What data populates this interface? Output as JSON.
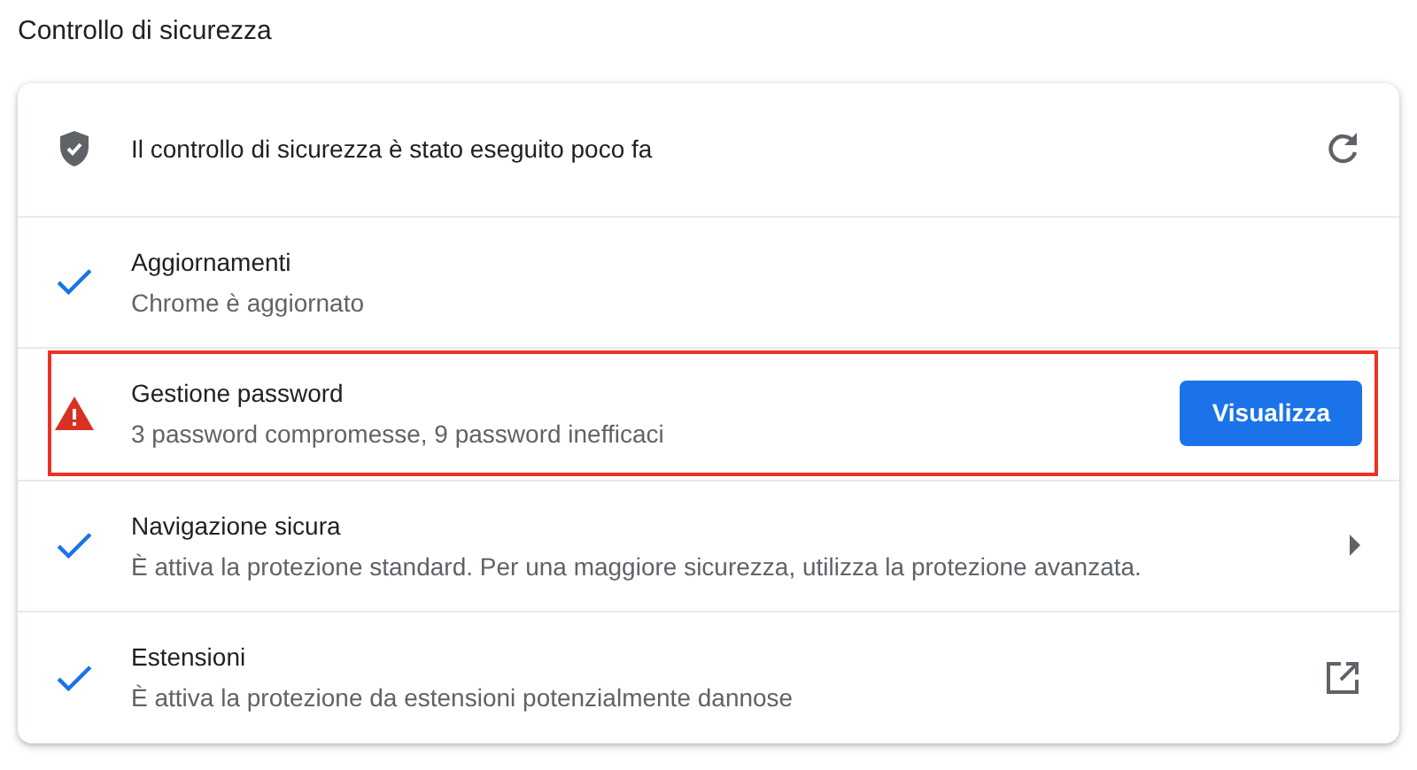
{
  "page_title": "Controllo di sicurezza",
  "header": {
    "text": "Il controllo di sicurezza è stato eseguito poco fa",
    "kind": "shield",
    "action": {
      "kind": "refresh"
    }
  },
  "items": [
    {
      "title": "Aggiornamenti",
      "subtitle": "Chrome è aggiornato",
      "kind": "check",
      "highlighted": false
    },
    {
      "title": "Gestione password",
      "subtitle": "3 password compromesse, 9 password inefficaci",
      "kind": "warning",
      "highlighted": true,
      "action": {
        "kind": "button",
        "label": "Visualizza"
      }
    },
    {
      "title": "Navigazione sicura",
      "subtitle": "È attiva la protezione standard. Per una maggiore sicurezza, utilizza la protezione avanzata.",
      "kind": "check",
      "highlighted": false,
      "action": {
        "kind": "arrow"
      }
    },
    {
      "title": "Estensioni",
      "subtitle": "È attiva la protezione da estensioni potenzialmente dannose",
      "kind": "check",
      "highlighted": false,
      "action": {
        "kind": "external"
      }
    }
  ]
}
